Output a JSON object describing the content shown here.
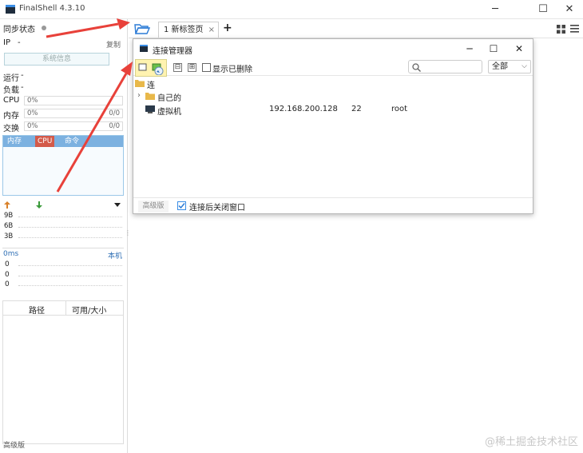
{
  "app": {
    "title": "FinalShell 4.3.10",
    "window_controls": {
      "minimize": "─",
      "maximize": "☐",
      "close": "✕"
    }
  },
  "sidebar": {
    "sync_label": "同步状态",
    "ip_label": "IP",
    "ip_value": "-",
    "copy_label": "复制",
    "sysinfo_button": "系统信息",
    "uptime_label": "运行",
    "uptime_value": "-",
    "load_label": "负载",
    "load_value": "-",
    "cpu_label": "CPU",
    "cpu_value": "0%",
    "mem_label": "内存",
    "mem_value": "0%",
    "mem_amount": "0/0",
    "swap_label": "交换",
    "swap_value": "0%",
    "swap_amount": "0/0",
    "proc_tabs": [
      "内存",
      "CPU",
      "命令"
    ],
    "net_up_icon": "arrow-up-icon",
    "net_down_icon": "arrow-down-icon",
    "net_levels": [
      "9B",
      "6B",
      "3B"
    ],
    "ping_label": "0ms",
    "ping_host": "本机",
    "ping_values": [
      "0",
      "0",
      "0"
    ],
    "disk_columns": [
      "路径",
      "可用/大小"
    ],
    "footer": "高级版"
  },
  "tabs": {
    "items": [
      {
        "label": "1 新标签页",
        "close": "×"
      }
    ],
    "add": "+"
  },
  "dialog": {
    "title": "连接管理器",
    "controls": {
      "minimize": "─",
      "maximize": "☐",
      "close": "✕"
    },
    "toolbar": {
      "collapse": "⊟",
      "expand": "⊞",
      "show_deleted_label": "显示已删除",
      "show_deleted_checked": false,
      "search_placeholder": "",
      "filter_value": "全部",
      "filter_arrow": "⌵"
    },
    "tree": {
      "folder_partial": "连",
      "folder": {
        "expander": "›",
        "label": "自己的"
      },
      "connection": {
        "name": "虚拟机",
        "host": "192.168.200.128",
        "port": "22",
        "user": "root"
      }
    },
    "footer": {
      "advanced_button": "高级版",
      "close_after_connect_label": "连接后关闭窗口",
      "close_after_connect_checked": true
    }
  },
  "watermark": "@稀土掘金技术社区",
  "colors": {
    "accent_blue": "#3a8ee6",
    "annotation_red": "#e8413a",
    "proc_header": "#7cb1e0",
    "proc_cpu_tab": "#d35a4a",
    "new_conn_highlight": "#fff3b0"
  }
}
